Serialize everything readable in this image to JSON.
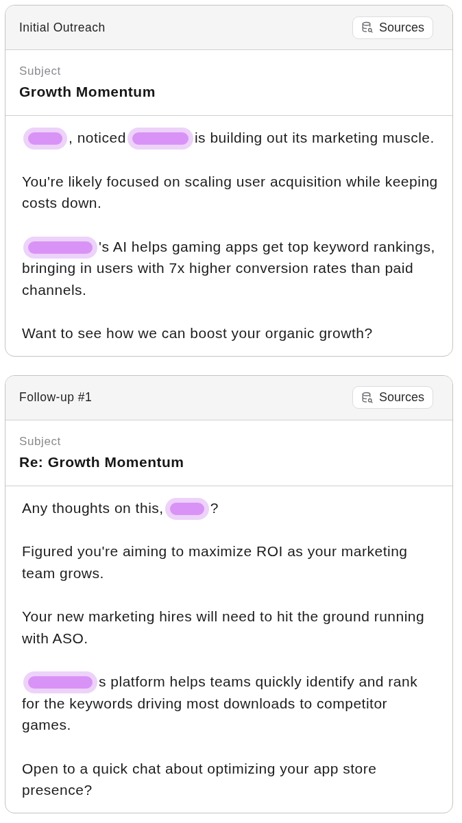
{
  "cards": [
    {
      "title": "Initial Outreach",
      "sources_button": "Sources",
      "subject_label": "Subject",
      "subject": "Growth Momentum",
      "paragraphs": [
        [
          {
            "kind": "redaction_short"
          },
          {
            "kind": "text",
            "text": ", noticed"
          },
          {
            "kind": "redaction_medium"
          },
          {
            "kind": "text",
            "text": "is building out its marketing muscle."
          }
        ],
        [
          {
            "kind": "text",
            "text": "You're likely focused on scaling user acquisition while keeping costs down."
          }
        ],
        [
          {
            "kind": "redaction_long"
          },
          {
            "kind": "text",
            "text": "'s AI helps gaming apps get top keyword rankings,"
          },
          {
            "kind": "text",
            "text": "bringing in users with 7x higher conversion rates than paid channels."
          }
        ],
        [
          {
            "kind": "text",
            "text": "Want to see how we can boost your organic growth?"
          }
        ]
      ]
    },
    {
      "title": "Follow-up #1",
      "sources_button": "Sources",
      "subject_label": "Subject",
      "subject": "Re: Growth Momentum",
      "paragraphs": [
        [
          {
            "kind": "text",
            "text": "Any thoughts on this,"
          },
          {
            "kind": "redaction_short"
          },
          {
            "kind": "text",
            "text": "?"
          }
        ],
        [
          {
            "kind": "text",
            "text": "Figured you're aiming to maximize ROI as your marketing team grows."
          }
        ],
        [
          {
            "kind": "text",
            "text": "Your new marketing hires will need to hit the ground running with ASO."
          }
        ],
        [
          {
            "kind": "redaction_long"
          },
          {
            "kind": "text",
            "text": "s platform helps teams quickly identify and rank"
          },
          {
            "kind": "text",
            "text": "for the keywords driving most downloads to competitor games."
          }
        ],
        [
          {
            "kind": "text",
            "text": "Open to a quick chat about optimizing your app store presence?"
          }
        ]
      ]
    }
  ]
}
